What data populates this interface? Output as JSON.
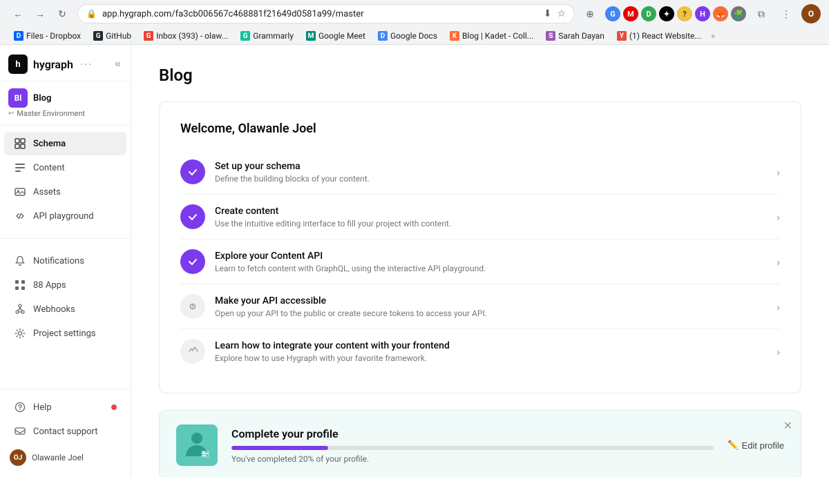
{
  "browser": {
    "url": "app.hygraph.com/fa3cb006567c468881f21649d0581a99/master",
    "nav_back_disabled": false,
    "nav_forward_disabled": true
  },
  "bookmarks": [
    {
      "id": "dropbox",
      "label": "Files - Dropbox",
      "color": "#0061FE",
      "char": "D"
    },
    {
      "id": "github",
      "label": "GitHub",
      "color": "#24292e",
      "char": "G"
    },
    {
      "id": "inbox",
      "label": "Inbox (393) - olaw...",
      "color": "#EA4335",
      "char": "G"
    },
    {
      "id": "grammarly",
      "label": "Grammarly",
      "color": "#15C39A",
      "char": "G"
    },
    {
      "id": "google-meet",
      "label": "Google Meet",
      "color": "#00897B",
      "char": "M"
    },
    {
      "id": "google-docs",
      "label": "Google Docs",
      "color": "#4285F4",
      "char": "D"
    },
    {
      "id": "blog-kadet",
      "label": "Blog | Kadet - Coll...",
      "color": "#FF6B35",
      "char": "K"
    },
    {
      "id": "sarah-dayan",
      "label": "Sarah Dayan",
      "color": "#9b59b6",
      "char": "S"
    },
    {
      "id": "react-website",
      "label": "(1) React Website...",
      "color": "#e74c3c",
      "char": "Y"
    }
  ],
  "sidebar": {
    "logo": "hygraph",
    "logo_dots": "···",
    "collapse_icon": "«",
    "project": {
      "initial": "Bl",
      "name": "Blog",
      "env_icon": "↩",
      "env_label": "Master Environment"
    },
    "nav_items": [
      {
        "id": "schema",
        "label": "Schema",
        "icon": "schema",
        "active": true
      },
      {
        "id": "content",
        "label": "Content",
        "icon": "content",
        "active": false
      },
      {
        "id": "assets",
        "label": "Assets",
        "icon": "assets",
        "active": false
      },
      {
        "id": "api-playground",
        "label": "API playground",
        "icon": "api",
        "active": false
      }
    ],
    "secondary_items": [
      {
        "id": "notifications",
        "label": "Notifications",
        "icon": "bell",
        "has_dot": false
      },
      {
        "id": "apps",
        "label": "Apps",
        "icon": "apps",
        "badge": "88",
        "has_dot": false
      },
      {
        "id": "webhooks",
        "label": "Webhooks",
        "icon": "webhooks",
        "has_dot": false
      },
      {
        "id": "project-settings",
        "label": "Project settings",
        "icon": "settings",
        "has_dot": false
      }
    ],
    "bottom_items": [
      {
        "id": "help",
        "label": "Help",
        "icon": "help",
        "has_dot": true
      },
      {
        "id": "contact-support",
        "label": "Contact support",
        "icon": "support",
        "has_dot": false
      }
    ],
    "user": {
      "name": "Olawanle Joel",
      "initials": "OJ"
    }
  },
  "main": {
    "page_title": "Blog",
    "welcome": {
      "heading": "Welcome, Olawanle Joel",
      "checklist": [
        {
          "id": "setup-schema",
          "done": true,
          "title": "Set up your schema",
          "description": "Define the building blocks of your content."
        },
        {
          "id": "create-content",
          "done": true,
          "title": "Create content",
          "description": "Use the intuitive editing interface to fill your project with content."
        },
        {
          "id": "explore-content-api",
          "done": true,
          "title": "Explore your Content API",
          "description": "Learn to fetch content with GraphQL, using the interactive API playground."
        },
        {
          "id": "make-api-accessible",
          "done": false,
          "title": "Make your API accessible",
          "description": "Open up your API to the public or create secure tokens to access your API."
        },
        {
          "id": "integrate-frontend",
          "done": false,
          "title": "Learn how to integrate your content with your frontend",
          "description": "Explore how to use Hygraph with your favorite framework."
        }
      ]
    },
    "profile_completion": {
      "title": "Complete your profile",
      "progress_percent": 20,
      "description": "You've completed 20% of your profile.",
      "edit_label": "Edit profile"
    }
  }
}
